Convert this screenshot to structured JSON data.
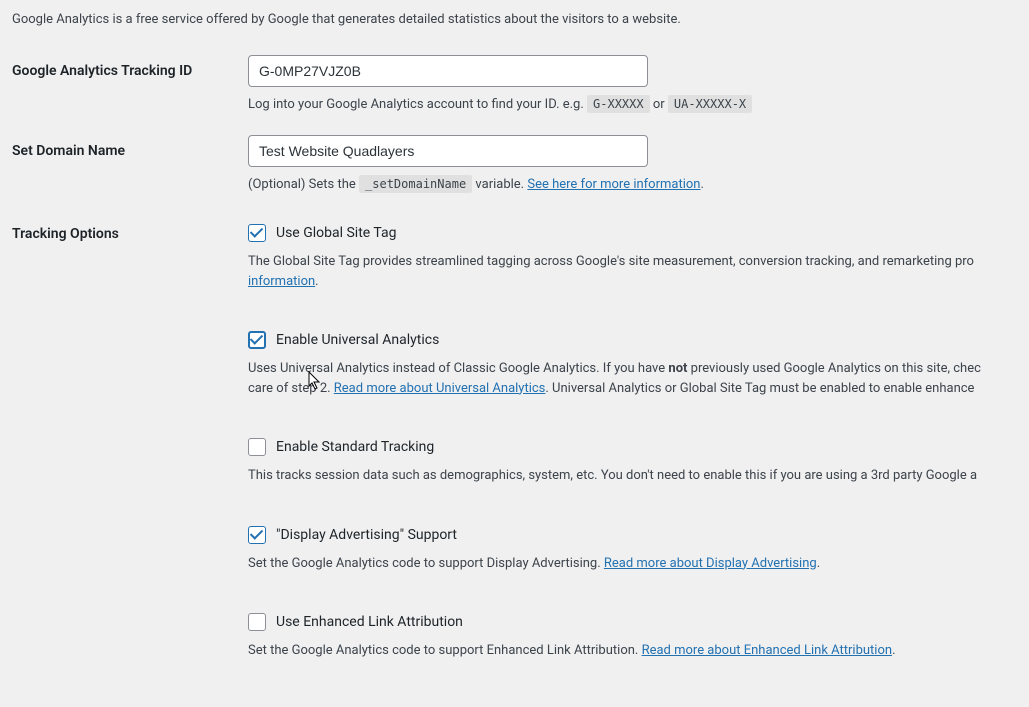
{
  "intro": "Google Analytics is a free service offered by Google that generates detailed statistics about the visitors to a website.",
  "tracking_id": {
    "label": "Google Analytics Tracking ID",
    "value": "G-0MP27VJZ0B",
    "help": "Log into your Google Analytics account to find your ID. e.g.",
    "code1": "G-XXXXX",
    "or": "or",
    "code2": "UA-XXXXX-X"
  },
  "domain": {
    "label": "Set Domain Name",
    "value": "Test Website Quadlayers",
    "help_pre": "(Optional) Sets the",
    "code": "_setDomainName",
    "help_post": "variable.",
    "link": "See here for more information"
  },
  "tracking": {
    "label": "Tracking Options",
    "global_tag": {
      "label": "Use Global Site Tag",
      "checked": true,
      "help_pre": "The Global Site Tag provides streamlined tagging across Google's site measurement, conversion tracking, and remarketing pro",
      "link": "information"
    },
    "universal": {
      "label": "Enable Universal Analytics",
      "checked": true,
      "help_pre": "Uses Universal Analytics instead of Classic Google Analytics. If you have ",
      "not": "not",
      "help_mid": " previously used Google Analytics on this site, chec",
      "line2_pre": "care of step 2. ",
      "link": "Read more about Universal Analytics",
      "help_post": ". Universal Analytics or Global Site Tag must be enabled to enable enhance"
    },
    "standard": {
      "label": "Enable Standard Tracking",
      "checked": false,
      "help": "This tracks session data such as demographics, system, etc. You don't need to enable this if you are using a 3rd party Google a"
    },
    "display_adv": {
      "label": "\"Display Advertising\" Support",
      "checked": true,
      "help_pre": "Set the Google Analytics code to support Display Advertising. ",
      "link": "Read more about Display Advertising"
    },
    "enhanced_link": {
      "label": "Use Enhanced Link Attribution",
      "checked": false,
      "help_pre": "Set the Google Analytics code to support Enhanced Link Attribution. ",
      "link": "Read more about Enhanced Link Attribution"
    }
  }
}
